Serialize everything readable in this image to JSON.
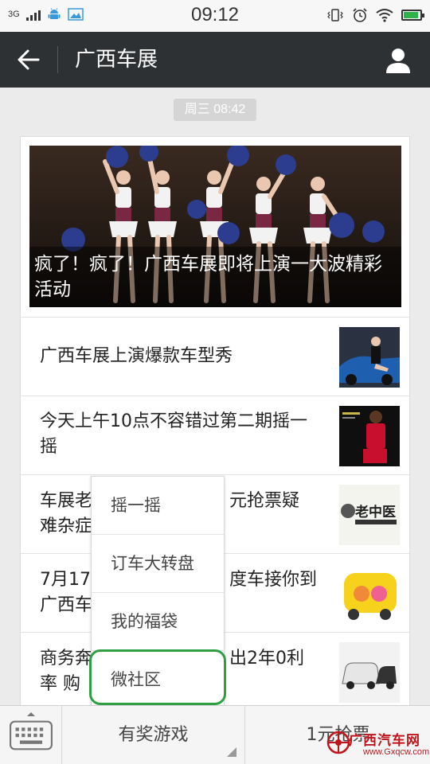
{
  "status_bar": {
    "network": "3G",
    "clock": "09:12",
    "battery_level": 0.9,
    "icons": [
      "signal-icon",
      "android-icon",
      "image-icon",
      "vibrate-icon",
      "alarm-icon",
      "wifi-icon",
      "battery-icon"
    ]
  },
  "header": {
    "title": "广西车展",
    "back_icon": "back-arrow-icon",
    "profile_icon": "person-icon"
  },
  "timestamp": "周三 08:42",
  "cover_article": {
    "title": "疯了！疯了！广西车展即将上演一大波精彩活动"
  },
  "articles": [
    {
      "title": "广西车展上演爆款车型秀"
    },
    {
      "title": "今天上午10点不容错过第二期摇一摇"
    },
    {
      "title": "车展老中医为您解答1元抢票疑难杂症",
      "visible_title": "车展老",
      "visible_title_cont": "元抢票疑",
      "visible_line2": "难杂症",
      "thumb_text": "老中医"
    },
    {
      "title": "7月17日…车接你到广西车展",
      "visible_title": "7月17",
      "visible_title_cont": "度车接你到",
      "visible_line2": "广西车"
    },
    {
      "title": "商务奔…出2年0利率 购…",
      "visible_title": "商务奔",
      "visible_title_cont": "出2年0利",
      "visible_line2": "率 购"
    }
  ],
  "popup_menu": {
    "items": [
      {
        "label": "摇一摇"
      },
      {
        "label": "订车大转盘"
      },
      {
        "label": "我的福袋"
      },
      {
        "label": "微社区"
      }
    ],
    "highlighted": "微社区"
  },
  "bottom_menu": {
    "keyboard_icon": "keyboard-icon",
    "items": [
      {
        "label": "有奖游戏"
      },
      {
        "label": "1元抢票"
      }
    ]
  },
  "watermark": {
    "title": "广西汽车网",
    "url": "www.Gxqcw.com"
  },
  "colors": {
    "title_bar": "#2e3134",
    "highlight_ring": "#2ea043",
    "battery": "#2db34a",
    "watermark": "#c0141a"
  }
}
